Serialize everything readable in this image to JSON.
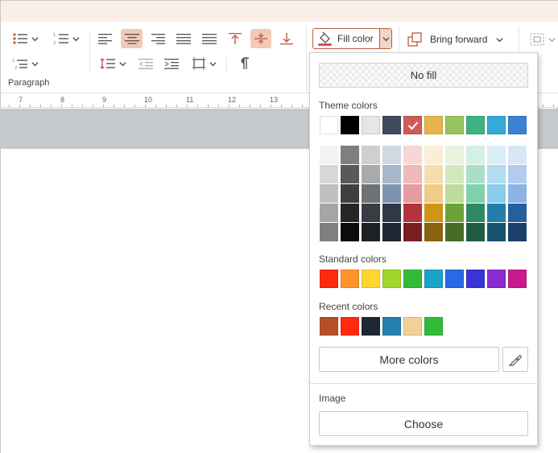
{
  "ribbon": {
    "group_label": "Paragraph",
    "fill_color_label": "Fill color",
    "bring_forward_label": "Bring forward",
    "fill_color_indicator": "#d9534f",
    "active_align": "align-center"
  },
  "ruler": {
    "numbers": [
      "7",
      "8",
      "9",
      "10",
      "11",
      "12",
      "13"
    ]
  },
  "fill_panel": {
    "no_fill_label": "No fill",
    "theme_colors_label": "Theme colors",
    "theme_colors": [
      "#ffffff",
      "#000000",
      "#e6e6e6",
      "#3e4b5e",
      "#d05a5a",
      "#e6b44a",
      "#96c460",
      "#3cb482",
      "#35a9d9",
      "#3a82d3"
    ],
    "selected_theme_index": 4,
    "theme_shades": [
      [
        "#f2f2f2",
        "#7f7f7f",
        "#cfcfcf",
        "#d0d9e3",
        "#f5d7d7",
        "#faeed7",
        "#e9f3de",
        "#d4efe3",
        "#d8eef8",
        "#d9e6f6"
      ],
      [
        "#d8d8d8",
        "#595959",
        "#a8aaac",
        "#a7b6c9",
        "#eeb9b9",
        "#f5deae",
        "#d3e8bd",
        "#a9dfc7",
        "#b0ddf1",
        "#b3ccee"
      ],
      [
        "#bfbfbf",
        "#3f3f3f",
        "#6d7277",
        "#7e94ae",
        "#e59c9c",
        "#f0cd86",
        "#bddc9c",
        "#7fd0ab",
        "#89cdea",
        "#8db3e5"
      ],
      [
        "#a5a5a5",
        "#262626",
        "#393d43",
        "#2e3a4a",
        "#b3333a",
        "#cf9517",
        "#6da238",
        "#2e8a61",
        "#227fa8",
        "#275f9e"
      ],
      [
        "#7f7f7f",
        "#0c0c0c",
        "#1e2126",
        "#1f2632",
        "#791f22",
        "#8a6310",
        "#496c25",
        "#1f5c40",
        "#165470",
        "#1a3f69"
      ]
    ],
    "standard_colors_label": "Standard colors",
    "standard_colors": [
      "#ff2a0e",
      "#ff9428",
      "#ffd630",
      "#a0d72c",
      "#33bb38",
      "#1aa3c7",
      "#2869e4",
      "#3b33d9",
      "#8a2bd2",
      "#c81a8b"
    ],
    "recent_colors_label": "Recent colors",
    "recent_colors": [
      "#b5502a",
      "#ff2a0e",
      "#1f2832",
      "#2380b0",
      "#f3d196",
      "#33bb38"
    ],
    "more_colors_label": "More colors",
    "image_label": "Image",
    "choose_label": "Choose"
  }
}
